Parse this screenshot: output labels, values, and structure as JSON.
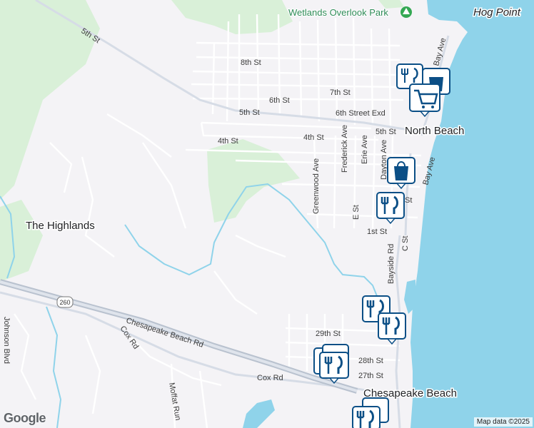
{
  "map": {
    "places": [
      {
        "id": "north-beach",
        "text": "North Beach"
      },
      {
        "id": "the-highlands",
        "text": "The Highlands"
      },
      {
        "id": "hog-point",
        "text": "Hog Point"
      },
      {
        "id": "chesapeake-beach",
        "text": "Chesapeake Beach"
      }
    ],
    "park": {
      "text": "Wetlands Overlook Park"
    },
    "streets": {
      "s5th_w": "5th St",
      "s8th": "8th St",
      "s7th": "7th St",
      "s6th": "6th St",
      "s5th_mid": "5th St",
      "s6th_ext": "6th Street Exd",
      "s5th_e": "5th St",
      "s4th_w": "4th St",
      "s4th_e": "4th St",
      "frederick": "Frederick Ave",
      "erie": "Erie Ave",
      "dayton": "Dayton Ave",
      "greenwood": "Greenwood Ave",
      "est": "E St",
      "st_frag": "St",
      "s1st": "1st St",
      "bayside": "Bayside Rd",
      "cst": "C St",
      "bayave_n": "Bay Ave",
      "bayave_s": "Bay Ave",
      "chesapeake_beach_rd": "Chesapeake Beach Rd",
      "cox_rd_w": "Cox Rd",
      "cox_rd_e": "Cox Rd",
      "moffat": "Moffat Run",
      "s29th": "29th St",
      "s28th": "28th St",
      "s27th": "27th St",
      "johnson": "Johnson Blvd"
    },
    "route_shield": "260",
    "pins": [
      {
        "id": "pin-restaurant-north-1",
        "icon": "restaurant"
      },
      {
        "id": "pin-shopping-north",
        "icon": "shopping-bag"
      },
      {
        "id": "pin-cart-north",
        "icon": "shopping-cart"
      },
      {
        "id": "pin-shopping-mid",
        "icon": "shopping-bag"
      },
      {
        "id": "pin-restaurant-mid",
        "icon": "restaurant"
      },
      {
        "id": "pin-restaurant-south-1",
        "icon": "restaurant"
      },
      {
        "id": "pin-restaurant-south-2",
        "icon": "restaurant"
      },
      {
        "id": "pin-restaurant-beach-1",
        "icon": "restaurant"
      },
      {
        "id": "pin-restaurant-beach-2",
        "icon": "restaurant"
      },
      {
        "id": "pin-restaurant-bottom",
        "icon": "restaurant"
      }
    ],
    "attribution": "Map data ©2025",
    "logo": "Google",
    "colors": {
      "water": "#8fd3ea",
      "land": "#f4f3f6",
      "park": "#d9f0d8",
      "pin": "#0b4f86",
      "pin_bg": "#ffffff",
      "road": "#cfd6e0",
      "highway": "#b9c2cf"
    }
  }
}
